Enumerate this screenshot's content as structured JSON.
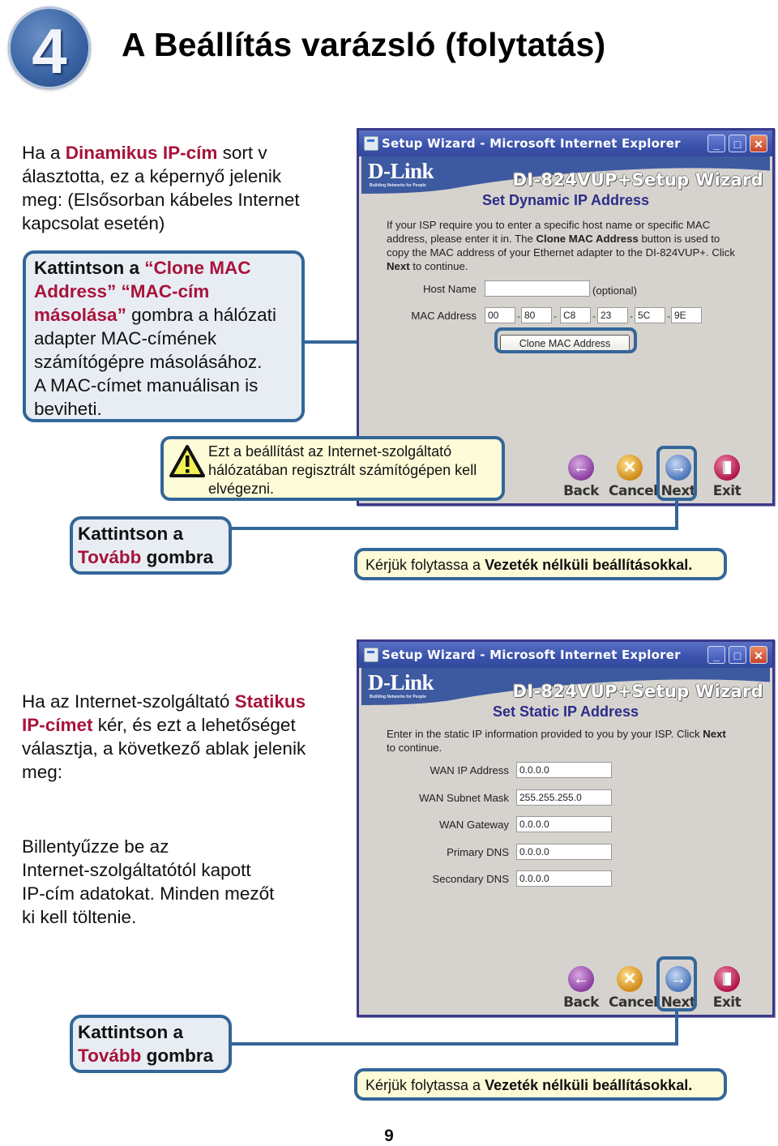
{
  "header": {
    "step_number": "4",
    "title": "A Beállítás varázsló (folytatás)"
  },
  "dynamic_section": {
    "intro": {
      "prefix": "Ha a ",
      "highlight": "Dinamikus IP-cím",
      "line1_rest": " sort v",
      "line2": "álasztotta, ez a képernyő jelenik",
      "line3": "meg: (Elsősorban kábeles Internet",
      "line4": "kapcsolat esetén)"
    },
    "clone_callout": {
      "prefix": "Kattintson a ",
      "highlight1": "“Clone MAC",
      "highlight2": "Address” “MAC-cím",
      "highlight3": "másolása”",
      "line3_rest": " gombra a hálózati",
      "line4": "adapter MAC-címének",
      "line5": "számítógépre másolásához.",
      "line6": "A MAC-címet manuálisan is",
      "line7": "beviheti."
    },
    "warning_callout": {
      "line1": "Ezt a beállítást az Internet-szolgáltató",
      "line2": "hálózatában regisztrált számítógépen kell",
      "line3": "elvégezni."
    },
    "next_callout": {
      "line1": "Kattintson a",
      "highlight": "Tovább",
      "line2_rest": " gombra"
    },
    "continue_note": {
      "prefix": "Kérjük folytassa a ",
      "bold": "Vezeték nélküli beállításokkal."
    },
    "window": {
      "title": "Setup Wizard - Microsoft Internet Explorer",
      "brand": "D-Link",
      "brand_tagline": "Building Networks for People",
      "wizard_name": "DI-824VUP+Setup Wizard",
      "heading": "Set Dynamic IP Address",
      "desc_line1": "If your ISP require you to enter a specific host name or specific MAC",
      "desc_line2_a": "address, please enter it in. The ",
      "desc_line2_bold": "Clone MAC Address",
      "desc_line2_b": " button is used to",
      "desc_line3": "copy the MAC address of your Ethernet adapter to the DI-824VUP+. Click",
      "desc_line4_bold": "Next",
      "desc_line4_rest": " to continue.",
      "host_name_label": "Host Name",
      "host_name_value": "",
      "host_name_hint": "(optional)",
      "mac_label": "MAC Address",
      "mac_octets": [
        "00",
        "80",
        "C8",
        "23",
        "5C",
        "9E"
      ],
      "clone_button": "Clone MAC Address",
      "nav": {
        "back": "Back",
        "cancel": "Cancel",
        "next": "Next",
        "exit": "Exit"
      }
    }
  },
  "static_section": {
    "intro": {
      "line1_prefix": "Ha az Internet-szolgáltató ",
      "highlight1": "Statikus",
      "highlight2": "IP-címet",
      "line2_rest": " kér, és ezt a lehetőséget",
      "line3": "választja, a következő ablak jelenik",
      "line4": "meg:"
    },
    "instruction": {
      "line1": "Billentyűzze be az",
      "line2": "Internet-szolgáltatótól kapott",
      "line3": "IP-cím adatokat. Minden mezőt",
      "line4": "ki kell töltenie."
    },
    "next_callout": {
      "line1": "Kattintson a",
      "highlight": "Tovább",
      "line2_rest": " gombra"
    },
    "continue_note": {
      "prefix": "Kérjük folytassa a ",
      "bold": "Vezeték nélküli beállításokkal."
    },
    "window": {
      "title": "Setup Wizard - Microsoft Internet Explorer",
      "brand": "D-Link",
      "brand_tagline": "Building Networks for People",
      "wizard_name": "DI-824VUP+Setup Wizard",
      "heading": "Set Static IP Address",
      "desc_line1_a": "Enter in the static IP information provided to you by your ISP. Click ",
      "desc_line1_bold": "Next",
      "desc_line2": "to continue.",
      "fields": [
        {
          "label": "WAN IP Address",
          "value": "0.0.0.0"
        },
        {
          "label": "WAN Subnet Mask",
          "value": "255.255.255.0"
        },
        {
          "label": "WAN Gateway",
          "value": "0.0.0.0"
        },
        {
          "label": "Primary DNS",
          "value": "0.0.0.0"
        },
        {
          "label": "Secondary DNS",
          "value": "0.0.0.0"
        }
      ],
      "nav": {
        "back": "Back",
        "cancel": "Cancel",
        "next": "Next",
        "exit": "Exit"
      }
    }
  },
  "colors": {
    "highlight_red": "#a8133a",
    "callout_border": "#336699",
    "callout_fill": "#e8edf4",
    "note_fill": "#fdfbd8",
    "window_heading": "#2c2c8a"
  },
  "footer": {
    "page_number": "9"
  }
}
